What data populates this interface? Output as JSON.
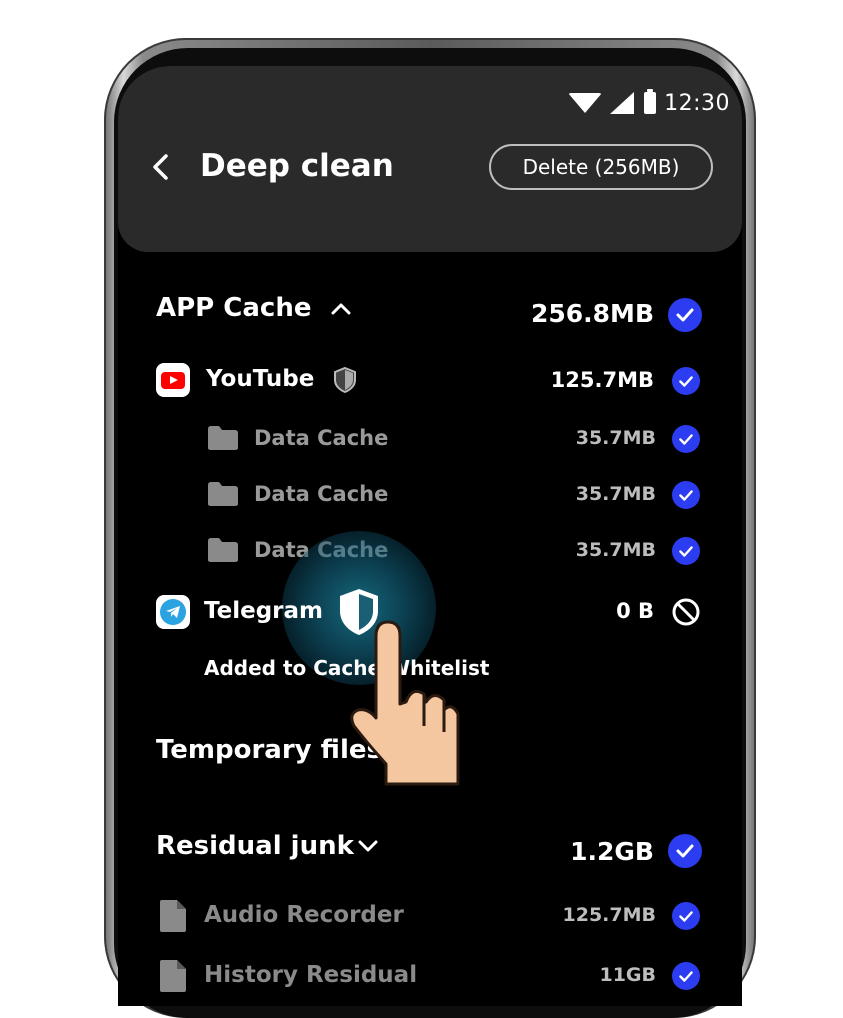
{
  "status_bar": {
    "time": "12:30",
    "icons": [
      "wifi-icon",
      "signal-icon",
      "battery-icon"
    ]
  },
  "header": {
    "title": "Deep clean",
    "delete_label": "Delete (256MB)"
  },
  "app_cache": {
    "title": "APP Cache",
    "size": "256.8MB",
    "expanded": true,
    "apps": [
      {
        "name": "YouTube",
        "size": "125.7MB",
        "icon": "youtube-icon",
        "items": [
          {
            "label": "Data Cache",
            "size": "35.7MB"
          },
          {
            "label": "Data Cache",
            "size": "35.7MB"
          },
          {
            "label": "Data Cache",
            "size": "35.7MB"
          }
        ]
      },
      {
        "name": "Telegram",
        "size": "0 B",
        "icon": "telegram-icon",
        "toast": "Added to Cache Whitelist"
      }
    ]
  },
  "temporary_files": {
    "title": "Temporary files"
  },
  "residual_junk": {
    "title": "Residual junk",
    "size": "1.2GB",
    "items": [
      {
        "label": "Audio Recorder",
        "size": "125.7MB"
      },
      {
        "label": "History Residual",
        "size": "11GB"
      }
    ]
  },
  "colors": {
    "accent": "#2c3cf0",
    "header_bg": "#2a2a2a",
    "screen_bg": "#000000",
    "whitelist_glow": "#28bee6"
  }
}
